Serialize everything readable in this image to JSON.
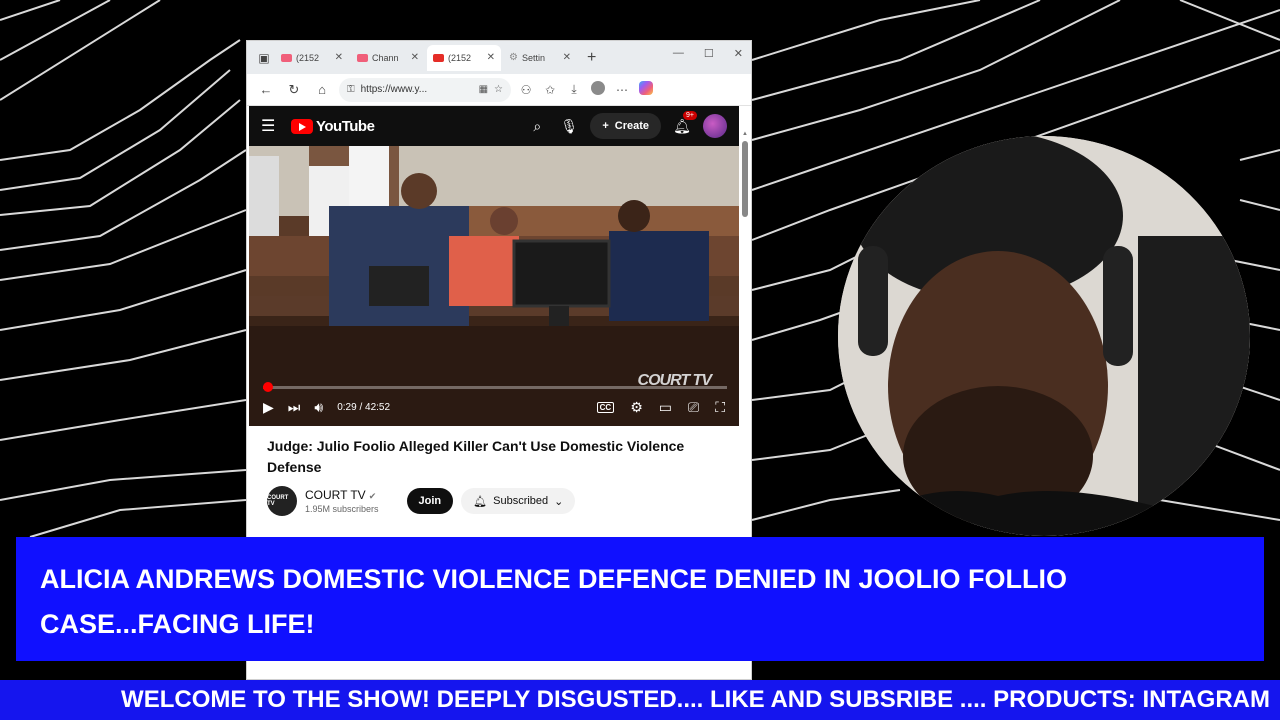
{
  "browser": {
    "tabs": [
      {
        "label": "(2152",
        "icon": "youtube-favicon",
        "active": false
      },
      {
        "label": "Chann",
        "icon": "youtube-studio-favicon",
        "active": false
      },
      {
        "label": "(2152",
        "icon": "youtube-favicon",
        "active": true
      },
      {
        "label": "Settin",
        "icon": "gear-icon",
        "active": false
      }
    ],
    "url": "https://www.y..."
  },
  "youtube": {
    "logo_text": "YouTube",
    "create_label": "Create",
    "notification_count": "9+",
    "player": {
      "time": "0:29 / 42:52",
      "progress": 0.0113,
      "watermark": "COURT TV"
    },
    "video_title": "Judge: Julio Foolio Alleged Killer Can't Use Domestic Violence Defense",
    "channel": {
      "name": "COURT TV",
      "avatar_text": "COURT TV",
      "subscribers": "1.95M subscribers",
      "join_label": "Join",
      "subscribed_label": "Subscribed"
    }
  },
  "overlay": {
    "headline": "ALICIA ANDREWS DOMESTIC VIOLENCE DEFENCE DENIED IN JOOLIO FOLLIO CASE...FACING LIFE!",
    "ticker": "WELCOME TO THE SHOW! DEEPLY DISGUSTED.... LIKE AND SUBSRIBE .... PRODUCTS: INTAGRAM"
  },
  "colors": {
    "banner_blue": "#1010ff",
    "ticker_blue": "#1515ee",
    "youtube_red": "#ff0000",
    "background": "#000000"
  }
}
